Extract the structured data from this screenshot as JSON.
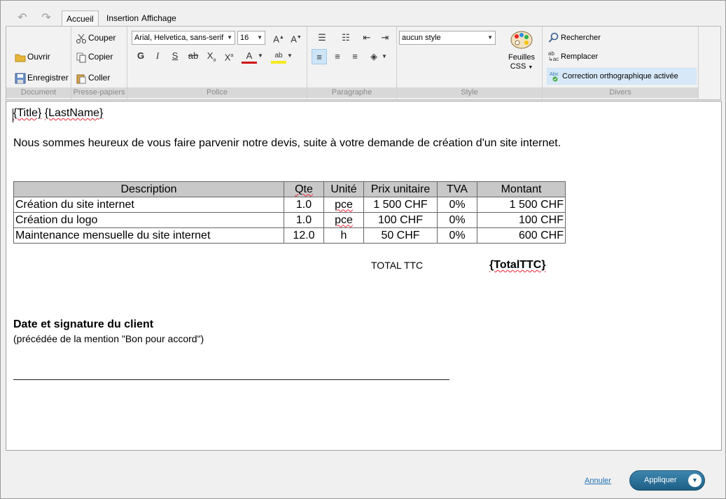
{
  "tabs": [
    "Accueil",
    "Insertion",
    "Affichage"
  ],
  "ribbon": {
    "groups": {
      "document": "Document",
      "clipboard": "Presse-papiers",
      "font": "Police",
      "paragraph": "Paragraphe",
      "style": "Style",
      "misc": "Divers"
    },
    "document": {
      "open": "Ouvrir",
      "save": "Enregistrer"
    },
    "clipboard": {
      "cut": "Couper",
      "copy": "Copier",
      "paste": "Coller"
    },
    "font": {
      "family": "Arial, Helvetica, sans-serif",
      "size": "16"
    },
    "style": {
      "value": "aucun style",
      "sheets_line1": "Feuilles",
      "sheets_line2": "CSS"
    },
    "misc": {
      "search": "Rechercher",
      "replace": "Remplacer",
      "spell": "Correction orthographique activée"
    }
  },
  "doc": {
    "title_field": "{Title}",
    "lastname_field": "{LastName}",
    "intro": "Nous sommes heureux de vous faire parvenir notre devis, suite à  votre demande de création d'un site internet.",
    "table": {
      "headers": [
        "Description",
        "Qte",
        "Unité",
        "Prix unitaire",
        "TVA",
        "Montant"
      ],
      "rows": [
        [
          "Création du site internet",
          "1.0",
          "pce",
          "1 500 CHF",
          "0%",
          "1 500 CHF"
        ],
        [
          "Création du logo",
          "1.0",
          "pce",
          "100 CHF",
          "0%",
          "100 CHF"
        ],
        [
          "Maintenance mensuelle du site internet",
          "12.0",
          "h",
          "50 CHF",
          "0%",
          "600 CHF"
        ]
      ]
    },
    "total_label": "TOTAL TTC",
    "total_value": "{TotalTTC}",
    "signature_title": "Date et signature du client",
    "signature_note": "(précédée de la mention \"Bon pour accord\")",
    "signature_line": "________________________________________________________________________________"
  },
  "footer": {
    "cancel": "Annuler",
    "apply": "Appliquer"
  }
}
